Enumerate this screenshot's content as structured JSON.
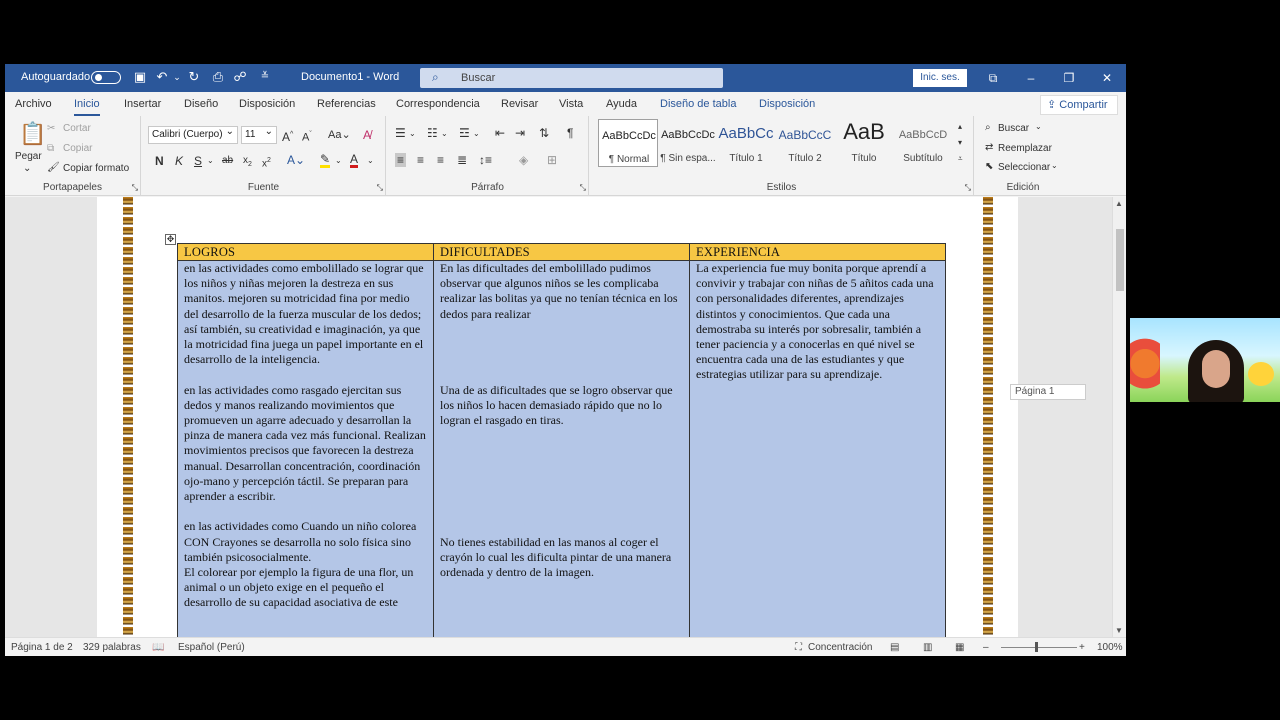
{
  "titlebar": {
    "autosave_label": "Autoguardado",
    "doc_title": "Documento1  -  Word",
    "search_placeholder": "Buscar",
    "signin_label": "Inic. ses."
  },
  "tabs": [
    "Archivo",
    "Inicio",
    "Insertar",
    "Diseño",
    "Disposición",
    "Referencias",
    "Correspondencia",
    "Revisar",
    "Vista",
    "Ayuda",
    "Diseño de tabla",
    "Disposición"
  ],
  "active_tab": "Inicio",
  "share_label": "Compartir",
  "ribbon": {
    "clipboard": {
      "paste": "Pegar",
      "cut": "Cortar",
      "copy": "Copiar",
      "format_painter": "Copiar formato",
      "group": "Portapapeles"
    },
    "font": {
      "family": "Calibri (Cuerpo)",
      "size": "11",
      "group": "Fuente"
    },
    "paragraph": {
      "group": "Párrafo"
    },
    "styles": {
      "group": "Estilos",
      "items": [
        {
          "preview": "AaBbCcDc",
          "name": "¶ Normal"
        },
        {
          "preview": "AaBbCcDc",
          "name": "¶ Sin espa..."
        },
        {
          "preview": "AaBbCc",
          "name": "Título 1"
        },
        {
          "preview": "AaBbCcC",
          "name": "Título 2"
        },
        {
          "preview": "AaB",
          "name": "Título"
        },
        {
          "preview": "AaBbCcD",
          "name": "Subtítulo"
        }
      ]
    },
    "editing": {
      "find": "Buscar",
      "replace": "Reemplazar",
      "select": "Seleccionar",
      "group": "Edición"
    }
  },
  "table": {
    "headers": [
      "LOGROS",
      "DIFICULTADES",
      "EXPERIENCIA"
    ],
    "logros": [
      "en las actividades como embolillado se lograr que los niños y niñas mejoren la destreza en sus manitos. mejoren su motricidad fina por medio del desarrollo de la fuerza muscular de los dedos; así también, su creatividad e imaginación, ya que la motricidad fina juega un papel importante en el desarrollo de la inteligencia.",
      "en las actividades como rasgado ejercitan sus dedos y manos realizando movimientos que promueven un agarre adecuado y desarrollan la pinza de manera cada vez más funcional. Realizan movimientos precisos que favorecen la destreza manual. Desarrollan concentración, coordinación ojo-mano y percepción táctil. Se preparan para aprender a escribir.",
      "en las actividades como Cuando un niño colorea CON Crayones se desarrolla no solo física sino también psicosocialmente.",
      "El colorear por ejemplo la figura de una flor, un animal o un objeto exige en el pequeño el desarrollo de su capacidad asociativa de este"
    ],
    "dificultades": [
      " En las dificultades del embolillado pudimos observar que algunos niños se les complicaba realizar las bolitas ya que no tenían técnica en los dedos para realizar",
      "Una de as dificultades que se logro observar que los niños lo hacen demasiado rápido que no lo logran el rasgado en tiras.",
      "No tienes estabilidad en las manos al coger el crayón lo cual les dificulta pintar de una manera ordenada y dentro de la imagen."
    ],
    "experiencia": "La experiencia fue muy bonita porque aprendí a convivir y trabajar con niñas de 5 añitos cada una con personalidades diferentes, aprendizajes distintos y conocimientos. Que cada una demostraba su interés por sobresalir, también a tener paciencia y a conocerlas en qué nivel se encuentra cada una de las estudiantes y que estrategias utilizar para su aprendizaje."
  },
  "page_tooltip": "Página 1",
  "status": {
    "page": "Página 1 de 2",
    "words": "329 palabras",
    "language": "Español (Perú)",
    "focus": "Concentración",
    "zoom": "100%"
  },
  "colors": {
    "titlebar": "#2b579a",
    "header_fill": "#f7c744",
    "cell_fill": "#b4c6e7"
  }
}
